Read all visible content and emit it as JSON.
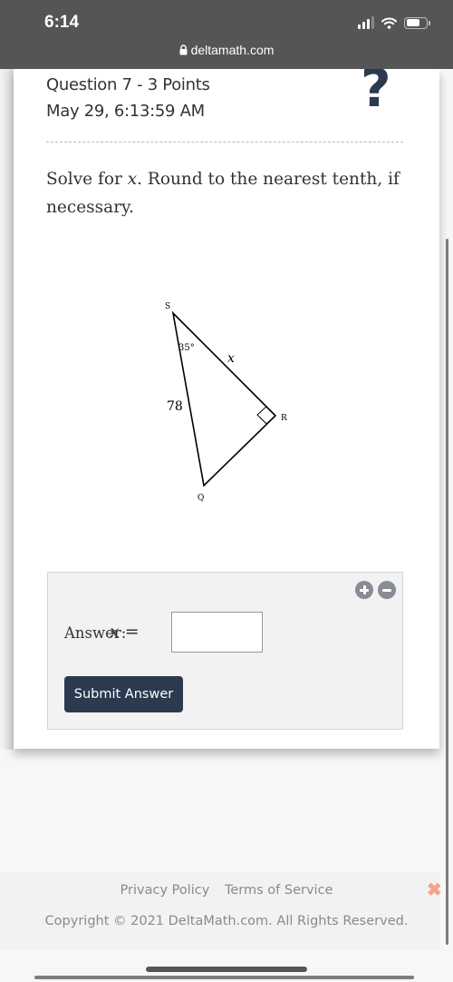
{
  "status_bar": {
    "time": "6:14",
    "icons": [
      "cellular-signal-icon",
      "wifi-icon",
      "battery-icon"
    ]
  },
  "browser": {
    "url": "deltamath.com",
    "lock_icon": "lock-icon"
  },
  "question": {
    "title": "Question 7 - 3 Points",
    "date": "May 29, 6:13:59 AM",
    "help_icon": "?",
    "prompt_pre": "Solve for ",
    "prompt_var": "x",
    "prompt_post": ". Round to the nearest tenth, if necessary."
  },
  "figure": {
    "vertices": {
      "S": "S",
      "R": "R",
      "Q": "Q"
    },
    "angle_label": "35°",
    "side_label_sq": "78",
    "side_label_sr": "x",
    "right_angle_at": "R"
  },
  "answer": {
    "label": "Answer:",
    "var": "x",
    "equals": "=",
    "input_value": "",
    "input_placeholder": "",
    "submit_label": "Submit Answer",
    "zoom_in_icon": "plus-circle-icon",
    "zoom_out_icon": "minus-circle-icon"
  },
  "footer": {
    "privacy": "Privacy Policy",
    "terms": "Terms of Service",
    "copyright": "Copyright © 2021 DeltaMath.com. All Rights Reserved.",
    "close_glyph": "✖"
  },
  "colors": {
    "primary_dark": "#2b3a4f",
    "close_x": "#f0a58c",
    "topbar": "#555555"
  }
}
